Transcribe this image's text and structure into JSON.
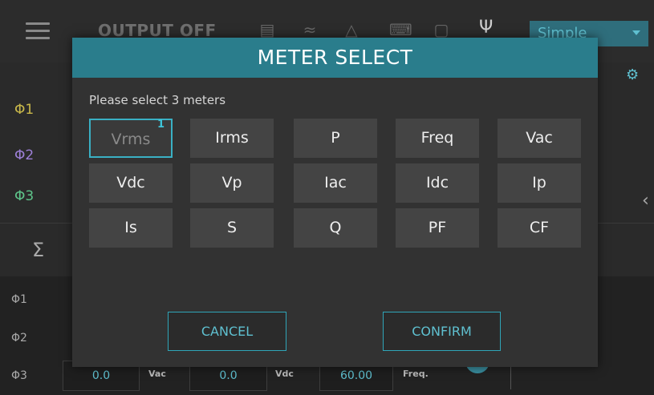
{
  "topbar": {
    "output_label": "OUTPUT OFF",
    "mode": "Simple",
    "icons": [
      "hamburger-icon",
      "chart-icon",
      "waveform-icon",
      "network-icon",
      "keyboard-icon",
      "screen-icon",
      "usb-icon",
      "gear-icon"
    ]
  },
  "phases": [
    "Φ1",
    "Φ2",
    "Φ3"
  ],
  "sigma": "Σ",
  "bottom": {
    "phases": [
      "Φ1",
      "Φ2",
      "Φ3"
    ],
    "row3": {
      "v1": "0.0",
      "u1": "Vac",
      "v2": "0.0",
      "u2": "Vdc",
      "v3": "60.00",
      "u3": "Freq."
    }
  },
  "dialog": {
    "title": "METER SELECT",
    "prompt": "Please select 3 meters",
    "meters": [
      [
        "Vrms",
        "Irms",
        "P",
        "Freq",
        "Vac"
      ],
      [
        "Vdc",
        "Vp",
        "Iac",
        "Idc",
        "Ip"
      ],
      [
        "Is",
        "S",
        "Q",
        "PF",
        "CF"
      ]
    ],
    "selected": {
      "label": "Vrms",
      "order": "1"
    },
    "cancel": "CANCEL",
    "confirm": "CONFIRM"
  },
  "colors": {
    "accent": "#2a7d8c",
    "accent_text": "#5fc0d0",
    "phi1": "#c9b84a",
    "phi2": "#9c7fd6",
    "phi3": "#5ec48a"
  }
}
